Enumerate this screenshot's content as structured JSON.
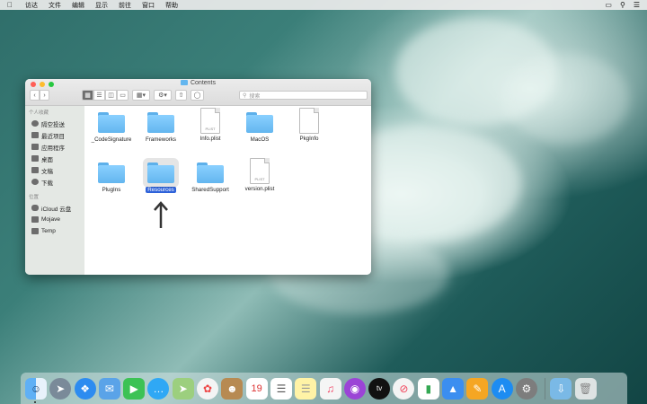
{
  "menubar": {
    "items": [
      "访达",
      "文件",
      "编辑",
      "显示",
      "前往",
      "窗口",
      "帮助"
    ]
  },
  "window": {
    "title": "Contents",
    "search_placeholder": "搜索",
    "sidebar": {
      "favorites_header": "个人收藏",
      "favorites": [
        {
          "label": "隔空投送",
          "icon": "airdrop-icon"
        },
        {
          "label": "最近项目",
          "icon": "recents-icon"
        },
        {
          "label": "应用程序",
          "icon": "applications-icon"
        },
        {
          "label": "桌面",
          "icon": "desktop-icon"
        },
        {
          "label": "文稿",
          "icon": "documents-icon"
        },
        {
          "label": "下载",
          "icon": "downloads-icon"
        }
      ],
      "locations_header": "位置",
      "locations": [
        {
          "label": "iCloud 云盘",
          "icon": "cloud-icon"
        },
        {
          "label": "Mojave",
          "icon": "drive-icon"
        },
        {
          "label": "Temp",
          "icon": "drive-icon"
        }
      ]
    },
    "files": [
      {
        "name": "_CodeSignature",
        "kind": "folder"
      },
      {
        "name": "Frameworks",
        "kind": "folder"
      },
      {
        "name": "Info.plist",
        "kind": "document",
        "doc_label": "PLIST"
      },
      {
        "name": "MacOS",
        "kind": "folder"
      },
      {
        "name": "PkgInfo",
        "kind": "document",
        "doc_label": ""
      },
      {
        "name": "PlugIns",
        "kind": "folder"
      },
      {
        "name": "Resources",
        "kind": "folder",
        "selected": true
      },
      {
        "name": "SharedSupport",
        "kind": "folder"
      },
      {
        "name": "version.plist",
        "kind": "document",
        "doc_label": "PLIST"
      }
    ]
  },
  "dock": {
    "calendar_day": "19",
    "apps": [
      "finder-icon",
      "launchpad-icon",
      "safari-icon",
      "mail-icon",
      "facetime-icon",
      "messages-icon",
      "maps-icon",
      "photos-icon",
      "contacts-icon",
      "calendar-icon",
      "reminders-icon",
      "notes-icon",
      "music-icon",
      "podcasts-icon",
      "tv-icon",
      "news-icon",
      "numbers-icon",
      "keynote-icon",
      "pages-icon",
      "app-store-icon",
      "system-preferences-icon"
    ]
  },
  "colors": {
    "folder": "#63b6ef",
    "selection": "#2e62d9"
  }
}
